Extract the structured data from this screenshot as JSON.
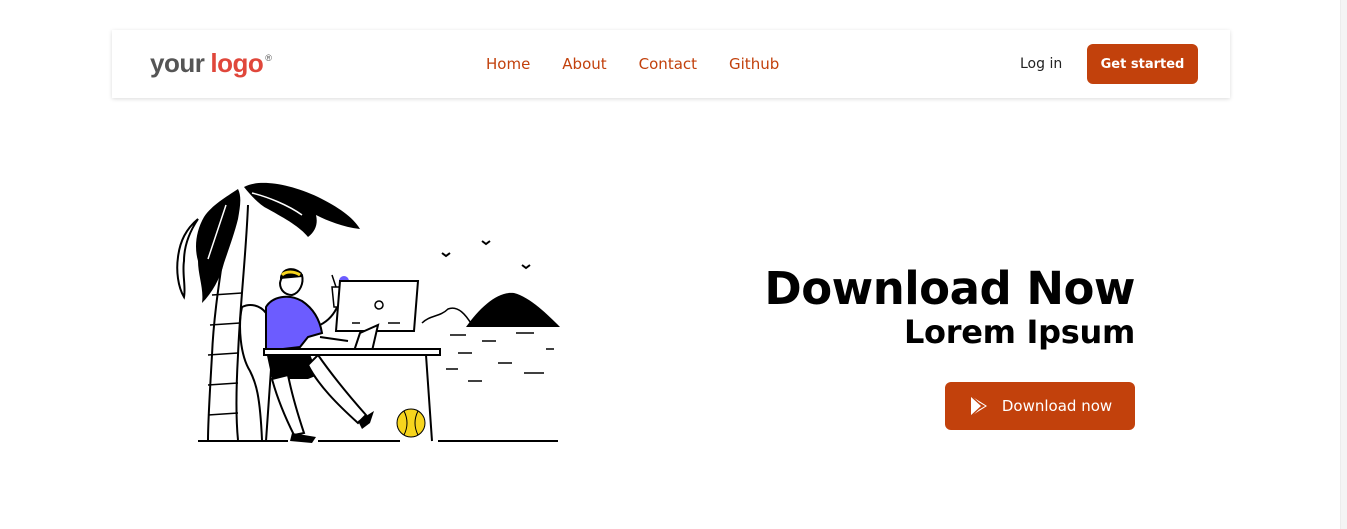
{
  "brand": {
    "logo_part1": "your",
    "logo_part2": "logo",
    "logo_mark": "®"
  },
  "nav": {
    "links": [
      {
        "label": "Home"
      },
      {
        "label": "About"
      },
      {
        "label": "Contact"
      },
      {
        "label": "Github"
      }
    ],
    "login_label": "Log in",
    "cta_label": "Get started"
  },
  "hero": {
    "title": "Download Now",
    "subtitle": "Lorem Ipsum",
    "download_label": "Download now",
    "download_icon": "google-play-icon",
    "illustration": "person-working-on-laptop-at-beach-illustration"
  },
  "colors": {
    "accent": "#c2410c",
    "logo_red": "#e0473b",
    "logo_gray": "#555555",
    "shirt_purple": "#6c5cff",
    "ball_yellow": "#f7d51d"
  }
}
